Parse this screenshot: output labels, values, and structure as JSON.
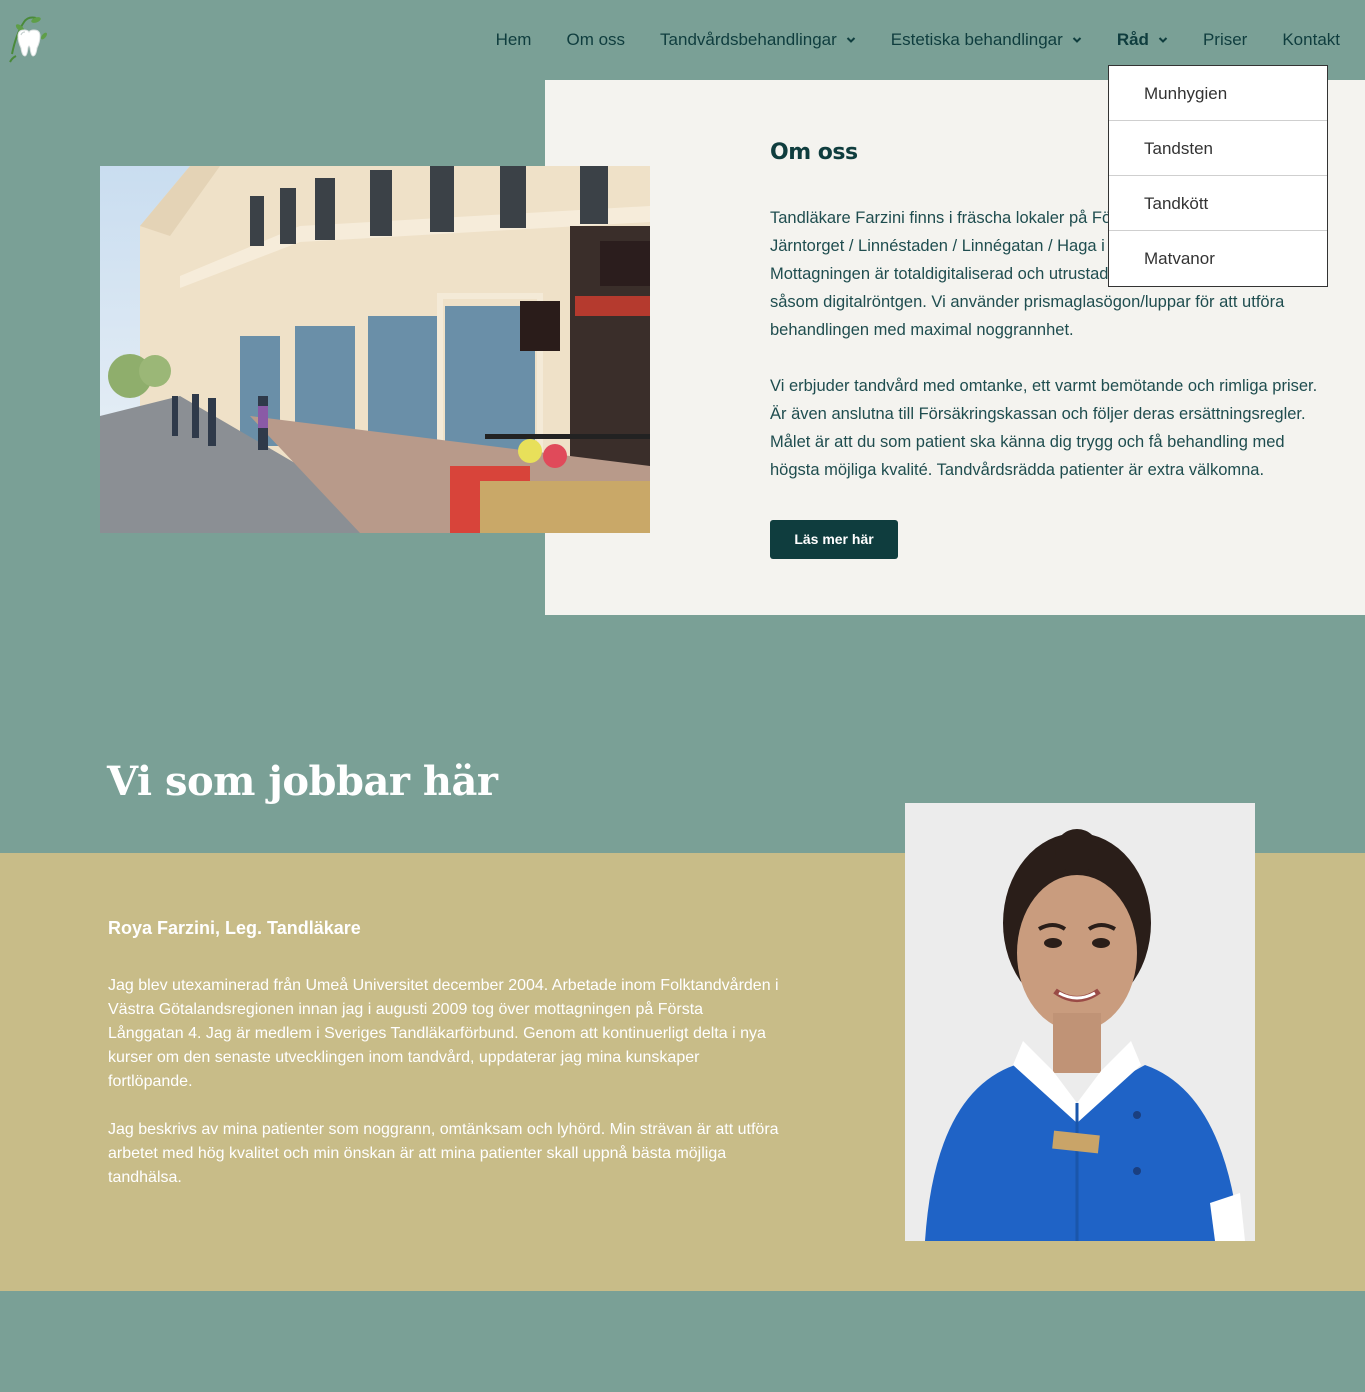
{
  "nav": {
    "items": [
      {
        "label": "Hem",
        "has_dropdown": false,
        "active": false
      },
      {
        "label": "Om oss",
        "has_dropdown": false,
        "active": false
      },
      {
        "label": "Tandvårdsbehandlingar",
        "has_dropdown": true,
        "active": false
      },
      {
        "label": "Estetiska behandlingar",
        "has_dropdown": true,
        "active": false
      },
      {
        "label": "Råd",
        "has_dropdown": true,
        "active": true
      },
      {
        "label": "Priser",
        "has_dropdown": false,
        "active": false
      },
      {
        "label": "Kontakt",
        "has_dropdown": false,
        "active": false
      }
    ],
    "dropdown": [
      "Munhygien",
      "Tandsten",
      "Tandkött",
      "Matvanor"
    ]
  },
  "about": {
    "title": "Om oss",
    "paragraph1": "Tandläkare Farzini finns i fräscha lokaler på Första Långgatan 4 vid Järntorget / Linnéstaden / Linnégatan / Haga i centrala Göteborg. Mottagningen är totaldigitaliserad och utrustad med den senaste teknologin såsom digitalröntgen. Vi använder prismaglasögon/luppar för att utföra behandlingen med maximal noggrannhet.",
    "paragraph2": "Vi erbjuder tandvård med omtanke, ett varmt bemötande och rimliga priser. Är även anslutna till Försäkringskassan och följer deras ersättningsregler. Målet är att du som patient ska känna dig trygg och få behandling med högsta möjliga kvalité. Tandvårdsrädda patienter är extra välkomna.",
    "button": "Läs mer här"
  },
  "staff": {
    "heading": "Vi som jobbar här",
    "name": "Roya Farzini, Leg. Tandläkare",
    "bio1": "Jag blev utexaminerad från Umeå Universitet december 2004. Arbetade inom Folktandvården i Västra Götalandsregionen innan jag i augusti 2009 tog över mottagningen på Första Långgatan 4. Jag är medlem i Sveriges Tandläkarförbund. Genom att kontinuerligt delta i nya kurser om den senaste utvecklingen inom tandvård, uppdaterar jag mina kunskaper fortlöpande.",
    "bio2": "Jag beskrivs av mina patienter som noggrann, omtänksam och lyhörd. Min strävan är att utföra arbetet med hög kvalitet och min önskan är att mina patienter skall uppnå bästa möjliga tandhälsa."
  },
  "colors": {
    "page_bg": "#7aa096",
    "panel_bg": "#f4f3ef",
    "staff_band": "#c8bc88",
    "accent_dark": "#0f3d3e"
  },
  "icons": {
    "logo": "tooth-logo-icon",
    "chevron": "chevron-down-icon"
  }
}
